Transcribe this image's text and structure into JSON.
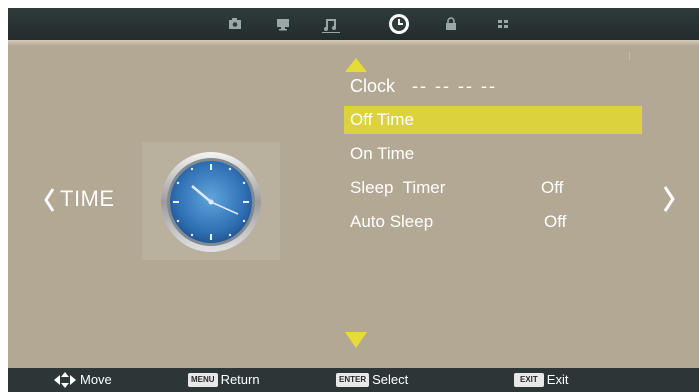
{
  "tabs": [
    {
      "icon": "picture-icon",
      "active": false
    },
    {
      "icon": "monitor-icon",
      "active": false
    },
    {
      "icon": "music-note-icon",
      "active": false
    },
    {
      "icon": "clock-icon",
      "active": true
    },
    {
      "icon": "lock-icon",
      "active": false
    },
    {
      "icon": "grid-icon",
      "active": false
    }
  ],
  "section": {
    "label": "TIME"
  },
  "menu": {
    "clock": {
      "label": "Clock",
      "value": "-- -- -- --"
    },
    "items": [
      {
        "label": "Off Time",
        "value": "",
        "selected": true
      },
      {
        "label": "On Time",
        "value": "",
        "selected": false
      },
      {
        "label": "Sleep  Timer",
        "value": "Off",
        "selected": false
      },
      {
        "label": "Auto Sleep",
        "value": "Off",
        "selected": false
      }
    ]
  },
  "help": {
    "move": {
      "label": "Move"
    },
    "return": {
      "key": "MENU",
      "label": "Return"
    },
    "select": {
      "key": "ENTER",
      "label": "Select"
    },
    "exit": {
      "key": "EXIT",
      "label": "Exit"
    }
  },
  "colors": {
    "panel": "#b3a893",
    "bar": "#2d3636",
    "highlight": "#dcd33c",
    "arrow": "#e6dc37"
  }
}
